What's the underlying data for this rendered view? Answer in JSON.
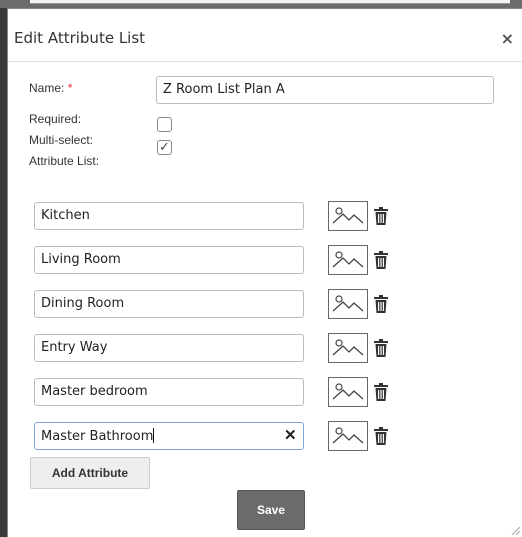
{
  "dialog": {
    "title": "Edit Attribute List",
    "close_label": "×"
  },
  "form": {
    "name_label": "Name:",
    "required_star": "*",
    "name_value": "Z Room List Plan A",
    "required_label": "Required:",
    "required_checked": false,
    "multiselect_label": "Multi-select:",
    "multiselect_checked": true,
    "attribute_list_label": "Attribute List:"
  },
  "attributes": [
    {
      "value": "Kitchen"
    },
    {
      "value": "Living Room"
    },
    {
      "value": "Dining Room"
    },
    {
      "value": "Entry Way"
    },
    {
      "value": "Master bedroom"
    },
    {
      "value": "Master Bathroom"
    }
  ],
  "icons": {
    "image": "image-placeholder-icon",
    "delete": "trash-icon",
    "clear": "clear-x-icon"
  },
  "buttons": {
    "add_attribute": "Add Attribute",
    "save": "Save"
  }
}
